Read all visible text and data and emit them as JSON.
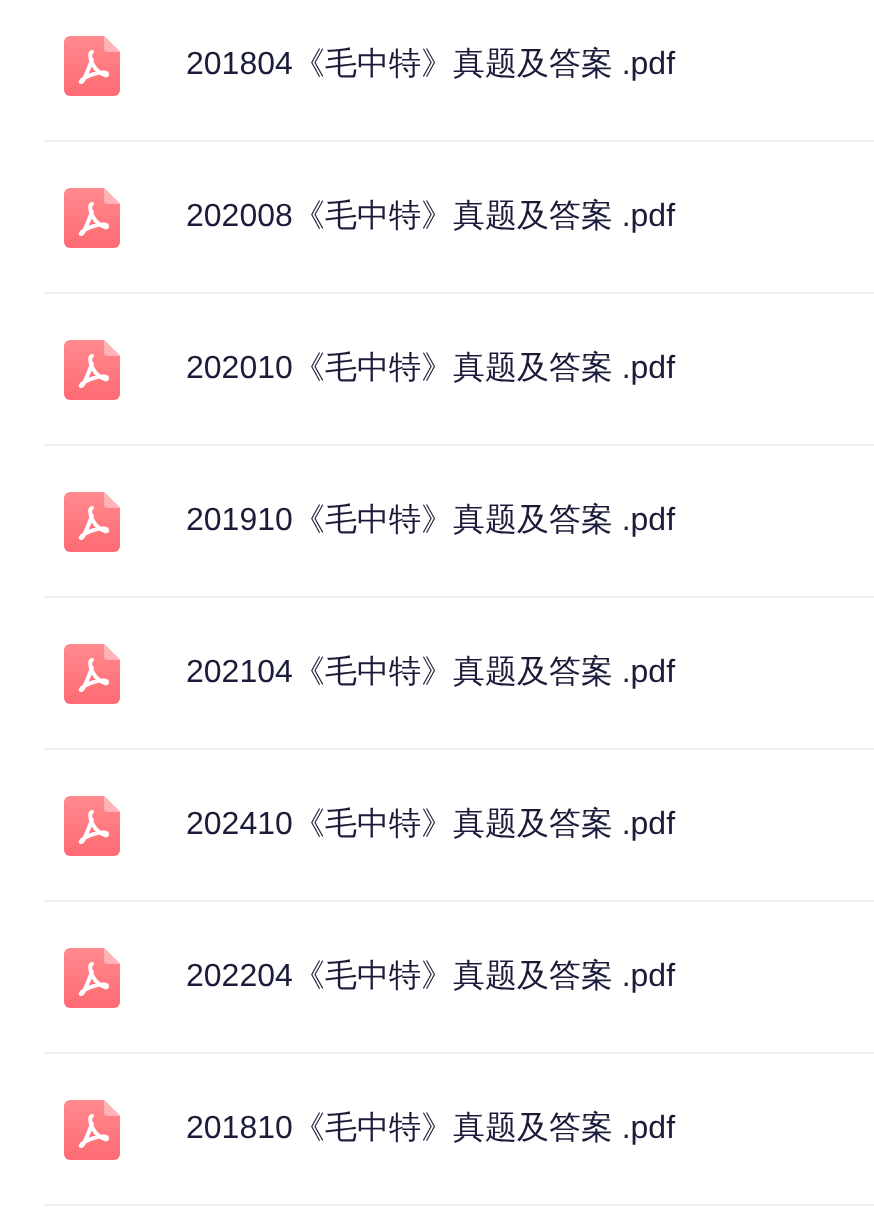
{
  "files": [
    {
      "name": "201804《毛中特》真题及答案 .pdf"
    },
    {
      "name": "202008《毛中特》真题及答案 .pdf"
    },
    {
      "name": "202010《毛中特》真题及答案 .pdf"
    },
    {
      "name": "201910《毛中特》真题及答案 .pdf"
    },
    {
      "name": "202104《毛中特》真题及答案 .pdf"
    },
    {
      "name": "202410《毛中特》真题及答案 .pdf"
    },
    {
      "name": "202204《毛中特》真题及答案 .pdf"
    },
    {
      "name": "201810《毛中特》真题及答案 .pdf"
    }
  ]
}
